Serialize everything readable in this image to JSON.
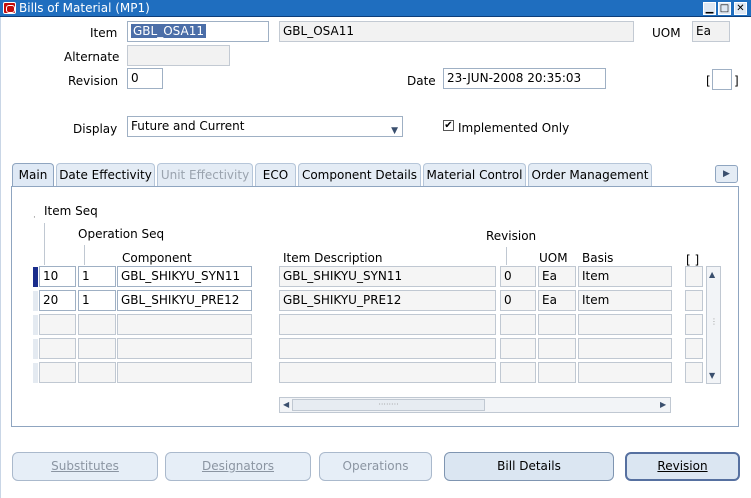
{
  "window": {
    "title": "Bills of Material (MP1)",
    "controls": [
      "minimize-icon",
      "maximize-icon",
      "close-icon"
    ]
  },
  "header": {
    "item_label": "Item",
    "item_value": "GBL_OSA11",
    "item_description": "GBL_OSA11",
    "uom_label": "UOM",
    "uom_value": "Ea",
    "alternate_label": "Alternate",
    "alternate_value": "",
    "revision_label": "Revision",
    "revision_value": "0",
    "date_label": "Date",
    "date_value": "23-JUN-2008 20:35:03",
    "bracket_label": "[",
    "bracket_value": "",
    "bracket_close": "]",
    "display_label": "Display",
    "display_value": "Future and Current",
    "implemented_only_label": "Implemented Only",
    "implemented_only_checked": true
  },
  "tabs": [
    {
      "label": "Main",
      "active": true,
      "disabled": false
    },
    {
      "label": "Date Effectivity",
      "active": false,
      "disabled": false
    },
    {
      "label": "Unit Effectivity",
      "active": false,
      "disabled": true
    },
    {
      "label": "ECO",
      "active": false,
      "disabled": false
    },
    {
      "label": "Component Details",
      "active": false,
      "disabled": false
    },
    {
      "label": "Material Control",
      "active": false,
      "disabled": false
    },
    {
      "label": "Order Management",
      "active": false,
      "disabled": false
    }
  ],
  "grid": {
    "item_seq_header": "Item Seq",
    "operation_seq_header": "Operation Seq",
    "component_header": "Component",
    "item_description_header": "Item Description",
    "revision_header": "Revision",
    "uom_header": "UOM",
    "basis_header": "Basis",
    "dff_header": "[ ]",
    "rows": [
      {
        "item_seq": "10",
        "op_seq": "1",
        "component": "GBL_SHIKYU_SYN11",
        "description": "GBL_SHIKYU_SYN11",
        "revision": "0",
        "uom": "Ea",
        "basis": "Item"
      },
      {
        "item_seq": "20",
        "op_seq": "1",
        "component": "GBL_SHIKYU_PRE12",
        "description": "GBL_SHIKYU_PRE12",
        "revision": "0",
        "uom": "Ea",
        "basis": "Item"
      },
      {
        "item_seq": "",
        "op_seq": "",
        "component": "",
        "description": "",
        "revision": "",
        "uom": "",
        "basis": ""
      },
      {
        "item_seq": "",
        "op_seq": "",
        "component": "",
        "description": "",
        "revision": "",
        "uom": "",
        "basis": ""
      },
      {
        "item_seq": "",
        "op_seq": "",
        "component": "",
        "description": "",
        "revision": "",
        "uom": "",
        "basis": ""
      }
    ]
  },
  "buttons": {
    "substitutes": "Substitutes",
    "designators": "Designators",
    "operations": "Operations",
    "bill_details": "Bill Details",
    "revision": "Revision"
  },
  "colors": {
    "titlebar": "#1f6ebf",
    "current_record": "#1a2d8c",
    "selection": "#4b6ea8"
  }
}
